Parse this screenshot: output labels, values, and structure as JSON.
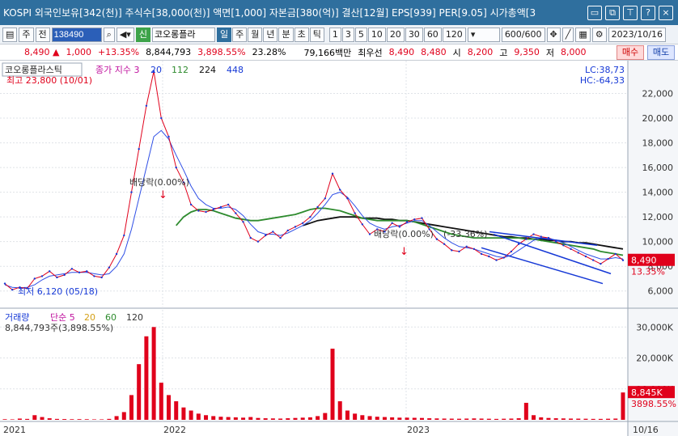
{
  "window": {
    "title": "KOSPI 외국인보유[342(천)] 주식수[38,000(천)] 액면[1,000] 자본금[380(억)] 결산[12월] EPS[939] PER[9.05] 시가총액[3",
    "icons": [
      "restore-icon",
      "new-window-icon",
      "pin-icon",
      "help-icon",
      "close-icon"
    ]
  },
  "toolbar": {
    "period_label": "주",
    "prev_label": "전",
    "code": "138490",
    "stock_name": "코오롱플라",
    "units": [
      "일",
      "주",
      "월",
      "년",
      "분",
      "초",
      "틱"
    ],
    "selected_unit": "일",
    "intervals": [
      "1",
      "3",
      "5",
      "10",
      "20",
      "30",
      "60",
      "120"
    ],
    "count": "600/600",
    "date": "2023/10/16"
  },
  "info": {
    "price": "8,490",
    "change": "1,000",
    "change_pct": "+13.35%",
    "volume": "8,844,793",
    "volume_pct": "3,898.55%",
    "turnover": "23.28%",
    "amount": "79,166백만",
    "best_ask_label": "최우선",
    "ask": "8,490",
    "bid": "8,480",
    "open_label": "시",
    "open": "8,200",
    "high_label": "고",
    "high": "9,350",
    "low_label": "저",
    "low": "8,000",
    "buy_label": "매수",
    "sell_label": "매도"
  },
  "chart_data": {
    "type": "line",
    "panel_title": "코오롱플라스틱",
    "indicator_label": "종가 지수 3",
    "ma_periods": [
      "20",
      "112",
      "224",
      "448"
    ],
    "lc": "LC:38,73",
    "hc": "HC:-64,33",
    "high_note": "최고 23,800 (10/01)",
    "low_note": "최저 6,120 (05/18)",
    "dividend_note": "배당락(0.00%)",
    "dividend_note2": "배당락(0.00%)",
    "trend_note": "(-33.36%)",
    "price_label": "8,490",
    "price_pct": "13.35%",
    "ylim": [
      5000,
      24000
    ],
    "yticks": [
      "22,000",
      "20,000",
      "18,000",
      "16,000",
      "14,000",
      "12,000",
      "10,000",
      "8,000",
      "6,000"
    ],
    "ytick_vals": [
      22000,
      20000,
      18000,
      16000,
      14000,
      12000,
      10000,
      8000,
      6000
    ],
    "xlabels": [
      "2021",
      "2022",
      "2023",
      "10/16"
    ],
    "series": [
      {
        "name": "종가",
        "color": "#1538d6",
        "values": [
          6600,
          6100,
          6300,
          6200,
          7000,
          7200,
          7600,
          7100,
          7300,
          7800,
          7500,
          7600,
          7200,
          7100,
          7900,
          9000,
          10500,
          14000,
          17500,
          21000,
          23800,
          20000,
          18500,
          16000,
          14800,
          13000,
          12500,
          12400,
          12600,
          12800,
          13000,
          12300,
          11600,
          10300,
          10000,
          10500,
          10800,
          10300,
          10900,
          11200,
          11500,
          12000,
          12800,
          13500,
          15500,
          14200,
          13500,
          12300,
          11400,
          10600,
          11000,
          10800,
          11500,
          11200,
          11600,
          11800,
          11900,
          11000,
          10200,
          9800,
          9300,
          9200,
          9600,
          9400,
          9000,
          8800,
          8500,
          8700,
          9200,
          9800,
          10200,
          10600,
          10400,
          10300,
          10000,
          9700,
          9400,
          9100,
          8800,
          8500,
          8200,
          8600,
          9000,
          8490
        ]
      },
      {
        "name": "20",
        "color": "#2f4fe6",
        "values": [
          6500,
          6300,
          6250,
          6300,
          6500,
          6900,
          7200,
          7300,
          7400,
          7500,
          7500,
          7500,
          7400,
          7300,
          7400,
          8000,
          9000,
          11000,
          13500,
          16000,
          18500,
          19000,
          18300,
          17000,
          15800,
          14500,
          13500,
          13000,
          12700,
          12700,
          12800,
          12600,
          12100,
          11400,
          10800,
          10600,
          10600,
          10500,
          10700,
          11000,
          11300,
          11700,
          12300,
          13000,
          13800,
          14000,
          13600,
          12900,
          12100,
          11500,
          11200,
          11000,
          11200,
          11300,
          11500,
          11700,
          11700,
          11300,
          10800,
          10300,
          9900,
          9600,
          9500,
          9400,
          9200,
          9000,
          8800,
          8700,
          8900,
          9300,
          9700,
          10100,
          10300,
          10300,
          10100,
          9900,
          9600,
          9300,
          9000,
          8800,
          8600,
          8600,
          8700,
          8600
        ]
      }
    ],
    "ma112": {
      "name": "112",
      "color": "#2e8b2e",
      "values": [
        null,
        null,
        null,
        null,
        null,
        null,
        null,
        null,
        null,
        null,
        null,
        null,
        null,
        null,
        null,
        null,
        null,
        null,
        null,
        null,
        null,
        null,
        null,
        11300,
        12000,
        12400,
        12600,
        12600,
        12500,
        12300,
        12100,
        11900,
        11800,
        11700,
        11700,
        11800,
        11900,
        12000,
        12100,
        12200,
        12400,
        12600,
        12700,
        12700,
        12600,
        12500,
        12300,
        12100,
        11900,
        11800,
        11700,
        11700,
        11700,
        11700,
        11700,
        11600,
        11400,
        11200,
        11000,
        10800,
        10600,
        10500,
        10400,
        10300,
        10300,
        10300,
        10300,
        10300,
        10300,
        10300,
        10200,
        10200,
        10100,
        10000,
        9900,
        9800,
        9700,
        9600,
        9500,
        9400,
        9200,
        9100,
        9000,
        8900
      ]
    },
    "ma224": {
      "name": "224",
      "color": "#111111",
      "values": [
        null,
        null,
        null,
        null,
        null,
        null,
        null,
        null,
        null,
        null,
        null,
        null,
        null,
        null,
        null,
        null,
        null,
        null,
        null,
        null,
        null,
        null,
        null,
        null,
        null,
        null,
        null,
        null,
        null,
        null,
        null,
        null,
        null,
        null,
        null,
        null,
        null,
        null,
        null,
        null,
        11300,
        11500,
        11700,
        11800,
        11900,
        12000,
        12000,
        12000,
        11900,
        11900,
        11900,
        11800,
        11800,
        11700,
        11700,
        11600,
        11500,
        11400,
        11300,
        11200,
        11100,
        11000,
        10900,
        10800,
        10700,
        10600,
        10500,
        10400,
        10400,
        10300,
        10300,
        10200,
        10200,
        10100,
        10100,
        10000,
        10000,
        9900,
        9900,
        9800,
        9700,
        9600,
        9500,
        9400
      ]
    },
    "volume_panel": {
      "title": "거래량",
      "ma_label": "단순 5",
      "ma_periods": [
        "20",
        "60",
        "120"
      ],
      "value_text": "8,844,793주(3,898.55%)",
      "yticks": [
        "30,000K",
        "20,000K",
        "10,000K"
      ],
      "ytick_vals": [
        30000,
        20000,
        10000
      ],
      "ylim": [
        0,
        34000
      ],
      "last_label": "8,845K",
      "last_pct": "3898.55%",
      "values": [
        200,
        150,
        400,
        300,
        1500,
        900,
        500,
        300,
        250,
        200,
        220,
        200,
        150,
        150,
        300,
        1200,
        2500,
        8000,
        18000,
        27000,
        30000,
        12000,
        8000,
        6000,
        4000,
        3000,
        2000,
        1500,
        1200,
        1000,
        900,
        800,
        700,
        900,
        600,
        500,
        450,
        400,
        500,
        600,
        700,
        800,
        1200,
        2200,
        23000,
        6000,
        3000,
        2000,
        1500,
        1200,
        1000,
        900,
        800,
        700,
        700,
        650,
        600,
        500,
        450,
        400,
        380,
        350,
        400,
        450,
        400,
        350,
        300,
        350,
        400,
        500,
        5500,
        1500,
        800,
        600,
        500,
        450,
        400,
        380,
        350,
        300,
        300,
        350,
        400,
        8845
      ]
    }
  }
}
